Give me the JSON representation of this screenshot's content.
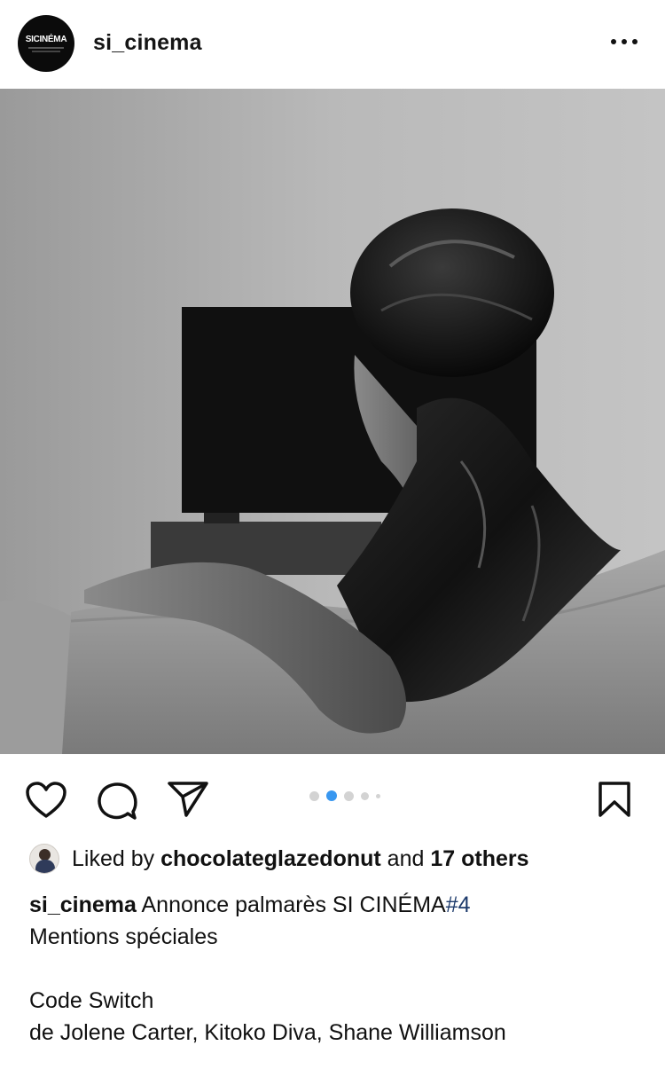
{
  "header": {
    "avatar_text": "SICINÉMA",
    "username": "si_cinema",
    "more_icon": "more-horizontal-icon"
  },
  "post": {
    "image_description_icon": "post-photo",
    "carousel": {
      "total": 5,
      "active_index": 1
    }
  },
  "actions": {
    "like_icon": "heart-icon",
    "comment_icon": "comment-icon",
    "share_icon": "send-icon",
    "save_icon": "bookmark-icon"
  },
  "likes": {
    "prefix": "Liked by",
    "user": "chocolateglazedonut",
    "middle": "and",
    "others": "17 others"
  },
  "caption": {
    "username": "si_cinema",
    "text": "Annonce palmarès SI CINÉMA",
    "hashtag": "#4",
    "line2": "Mentions spéciales",
    "line3": "Code Switch",
    "line4": "de Jolene Carter, Kitoko Diva, Shane Williamson"
  },
  "colors": {
    "accent_dot": "#3897f0",
    "hashtag": "#1c3a6b",
    "text": "#111111"
  }
}
